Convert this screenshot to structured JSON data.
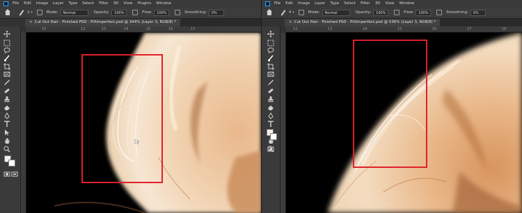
{
  "colors": {
    "highlight": "#e0202a",
    "hair_light": "#f3dcc0",
    "hair_mid": "#e6b588",
    "hair_dark": "#b67a4f",
    "background": "#000000"
  },
  "menu": [
    "File",
    "Edit",
    "Image",
    "Layer",
    "Type",
    "Select",
    "Filter",
    "3D",
    "View",
    "Plugins",
    "Window"
  ],
  "panes": [
    {
      "options": {
        "brush_size": "2",
        "mode_label": "Mode:",
        "mode_value": "Normal",
        "opacity_label": "Opacity:",
        "opacity_value": "100%",
        "flow_label": "Flow:",
        "flow_value": "100%",
        "smoothing_label": "Smoothing:",
        "smoothing_value": "0%"
      },
      "tab": {
        "close": "×",
        "title": "Cut Out Hair - Finished PSD - PiXimperfect.psd @ 344% (Layer 3, RGB/8) *"
      },
      "ruler_ticks": [
        "10",
        "12",
        "13",
        "14",
        "15",
        "16",
        "17"
      ]
    },
    {
      "options": {
        "brush_size": "4",
        "mode_label": "Mode:",
        "mode_value": "Normal",
        "opacity_label": "Opacity:",
        "opacity_value": "100%",
        "flow_label": "Flow:",
        "flow_value": "100%",
        "smoothing_label": "Smoothing:",
        "smoothing_value": "0%"
      },
      "tab": {
        "close": "×",
        "title": "Cut Out Hair - Finished PSD - PiXimperfect.psd @ 536% (Layer 3, RGB/8) *"
      },
      "ruler_ticks": [
        "12",
        "13",
        "14",
        "15",
        "16",
        "17",
        "18"
      ]
    }
  ]
}
